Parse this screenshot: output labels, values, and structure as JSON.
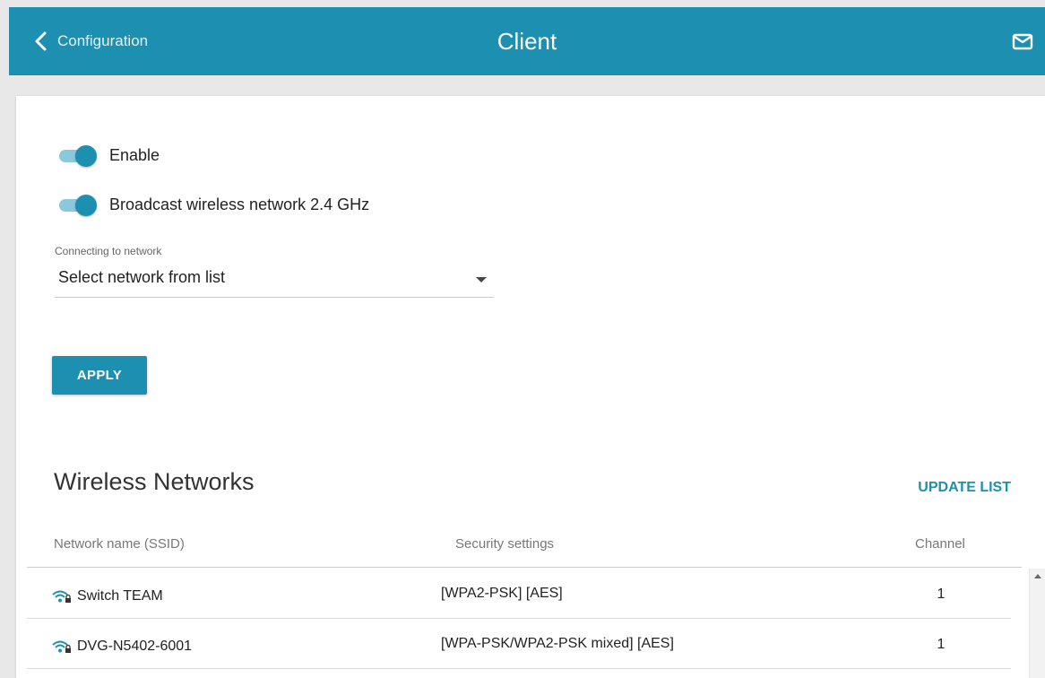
{
  "header": {
    "back_label": "Configuration",
    "title": "Client",
    "back_icon": "chevron-left-icon",
    "mail_icon": "mail-icon"
  },
  "form": {
    "enable_label": "Enable",
    "broadcast_label": "Broadcast wireless network 2.4 GHz",
    "connecting_label": "Connecting to network",
    "connecting_value": "Select network from list",
    "apply_label": "APPLY"
  },
  "networks": {
    "title": "Wireless Networks",
    "update_label": "UPDATE LIST",
    "columns": [
      "Network name (SSID)",
      "Security settings",
      "Channel"
    ],
    "rows": [
      {
        "ssid": "Switch TEAM",
        "security": "[WPA2-PSK] [AES]",
        "channel": "1"
      },
      {
        "ssid": "DVG-N5402-6001",
        "security": "[WPA-PSK/WPA2-PSK mixed] [AES]",
        "channel": "1"
      }
    ]
  },
  "colors": {
    "accent": "#1d8fb0"
  }
}
